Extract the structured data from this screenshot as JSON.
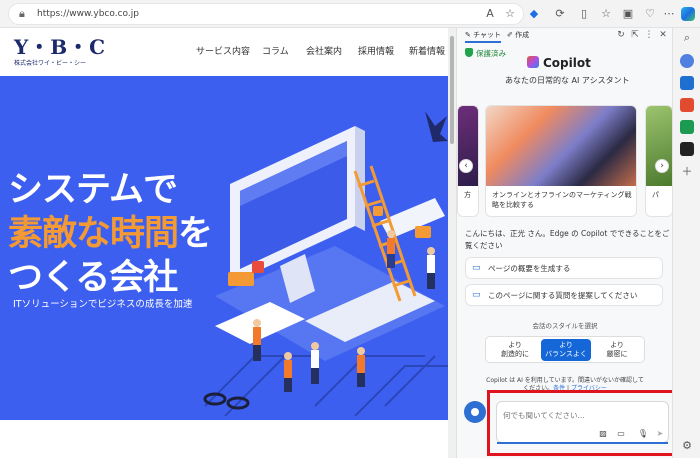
{
  "browser": {
    "url": "https://www.ybco.co.jp",
    "read_aloud": "A",
    "icons": [
      "lock-icon",
      "read-aloud-icon",
      "favorite-star-icon",
      "extension-icon",
      "split-screen-icon",
      "favorites-icon",
      "collections-icon",
      "performance-icon",
      "more-icon"
    ]
  },
  "site": {
    "logo_mark": "Y・B・C",
    "logo_sub": "株式会社ワイ・ビー・シー",
    "nav": [
      "サービス内容",
      "コラム",
      "会社案内",
      "採用情報",
      "新着情報"
    ],
    "hero_line1": "システムで",
    "hero_line2_accent": "素敵な時間",
    "hero_line2_tail": "を",
    "hero_line3": "つくる会社",
    "hero_sub": "ITソリューションでビジネスの成長を加速",
    "colors": {
      "hero_bg": "#3d5ff0",
      "accent": "#f39a34"
    }
  },
  "copilot": {
    "tabs": [
      {
        "label": "チャット",
        "active": true
      },
      {
        "label": "作成",
        "active": false
      }
    ],
    "protected": "保護済み",
    "title": "Copilot",
    "tagline": "あなたの日常的な AI アシスタント",
    "cards": [
      {
        "caption": "方"
      },
      {
        "caption": "オンラインとオフラインのマーケティング戦略を比較する"
      },
      {
        "caption": "パ"
      }
    ],
    "greeting": "こんにちは、正光 さん。Edge の Copilot でできることをご覧ください",
    "suggestions": [
      "ページの概要を生成する",
      "このページに関する質問を提案してください"
    ],
    "style_label": "会話のスタイルを選択",
    "styles": [
      {
        "line1": "より",
        "line2": "創造的に",
        "active": false
      },
      {
        "line1": "より",
        "line2": "バランスよく",
        "active": true
      },
      {
        "line1": "より",
        "line2": "厳密に",
        "active": false
      }
    ],
    "notice_line1": "Copilot は AI を利用しています。間違いがないか確認して",
    "notice_line2_prefix": "ください。",
    "notice_terms": "条件",
    "notice_sep": " | ",
    "notice_privacy": "プライバシー",
    "chat_placeholder": "何でも聞いてください...",
    "colors": {
      "primary": "#1567d8",
      "highlight_box": "#e0141e"
    }
  }
}
